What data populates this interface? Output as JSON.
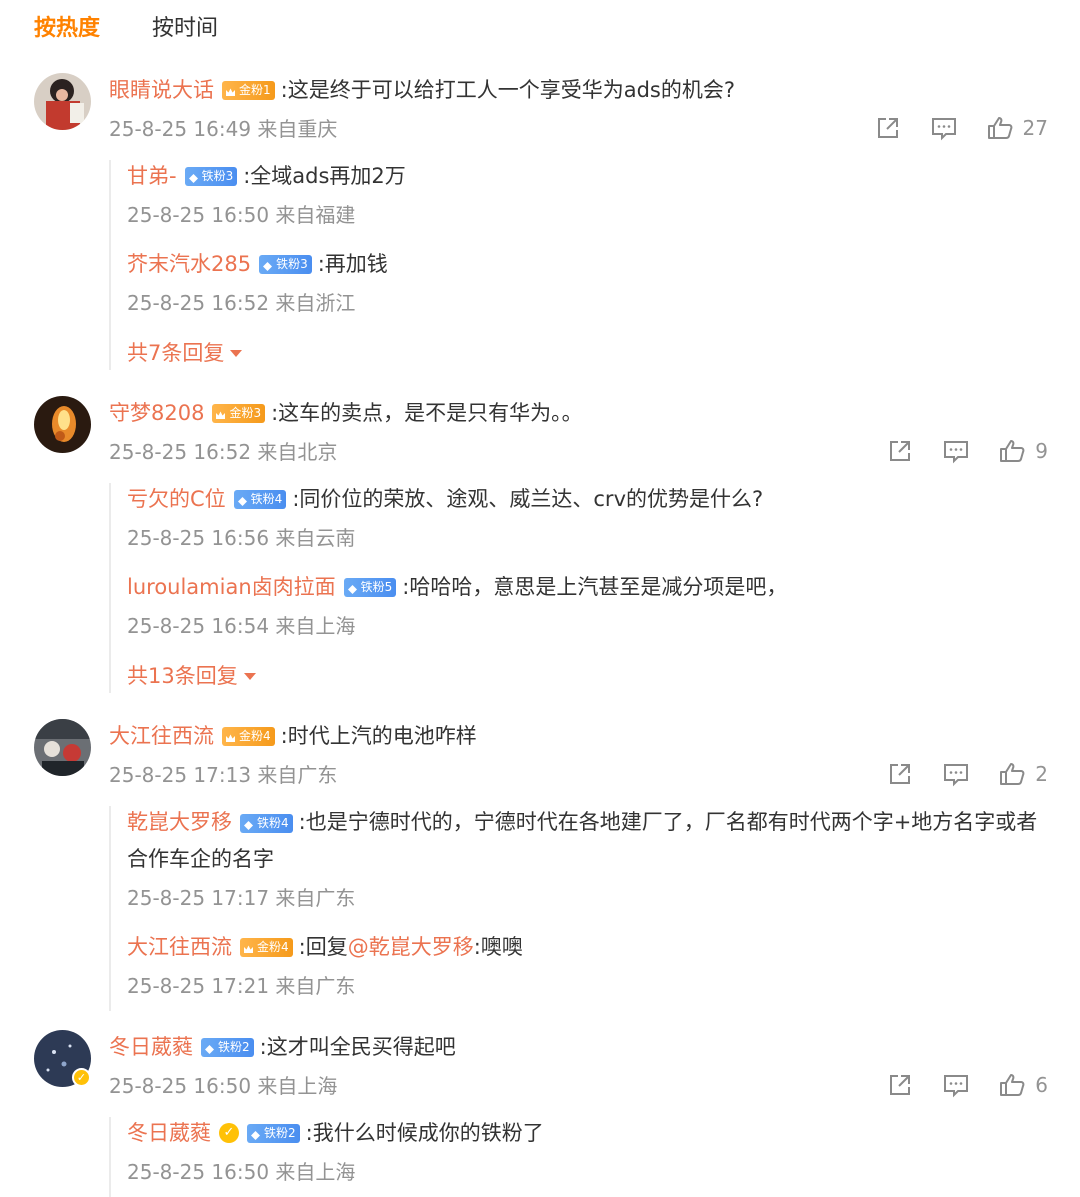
{
  "tabs": [
    {
      "label": "按热度"
    },
    {
      "label": "按时间"
    }
  ],
  "comments": [
    {
      "user": "眼睛说大话",
      "badge": "金粉1",
      "badge_type": "gold",
      "text": ":这是终于可以给打工人一个享受华为ads的机会?",
      "time": "25-8-25 16:49 来自重庆",
      "likes": "27",
      "replies": [
        {
          "user": "甘弟-",
          "badge": "铁粉3",
          "text": ":全域ads再加2万",
          "time": "25-8-25 16:50 来自福建"
        },
        {
          "user": "芥末汽水285",
          "badge": "铁粉3",
          "text": ":再加钱",
          "time": "25-8-25 16:52 来自浙江"
        }
      ],
      "more": "共7条回复"
    },
    {
      "user": "守梦8208",
      "badge": "金粉3",
      "badge_type": "gold",
      "text": ":这车的卖点，是不是只有华为。。",
      "time": "25-8-25 16:52 来自北京",
      "likes": "9",
      "replies": [
        {
          "user": "亏欠的C位",
          "badge": "铁粉4",
          "text": ":同价位的荣放、途观、威兰达、crv的优势是什么?",
          "time": "25-8-25 16:56 来自云南"
        },
        {
          "user": "luroulamian卤肉拉面",
          "badge": "铁粉5",
          "text": ":哈哈哈，意思是上汽甚至是减分项是吧，",
          "time": "25-8-25 16:54 来自上海"
        }
      ],
      "more": "共13条回复"
    },
    {
      "user": "大江往西流",
      "badge": "金粉4",
      "badge_type": "gold",
      "text": ":时代上汽的电池咋样",
      "time": "25-8-25 17:13 来自广东",
      "likes": "2",
      "replies": [
        {
          "user": "乾崑大罗移",
          "badge": "铁粉4",
          "text": ":也是宁德时代的，宁德时代在各地建厂了，厂名都有时代两个字+地方名字或者合作车企的名字",
          "time": "25-8-25 17:17 来自广东"
        },
        {
          "user": "大江往西流",
          "badge": "金粉4",
          "text_prefix": ":回复",
          "at": "@乾崑大罗移",
          "text": ":噢噢",
          "time": "25-8-25 17:21 来自广东"
        }
      ]
    },
    {
      "user": "冬日葳蕤",
      "badge": "铁粉2",
      "badge_type": "iron",
      "text": ":这才叫全民买得起吧",
      "time": "25-8-25 16:50 来自上海",
      "likes": "6",
      "replies": [
        {
          "user": "冬日葳蕤",
          "verified": "v",
          "badge": "铁粉2",
          "text": ":我什么时候成你的铁粉了",
          "time": "25-8-25 16:50 来自上海"
        }
      ]
    }
  ],
  "colors": {
    "accent": "#ff8200",
    "username": "#eb7350",
    "meta": "#939393"
  }
}
